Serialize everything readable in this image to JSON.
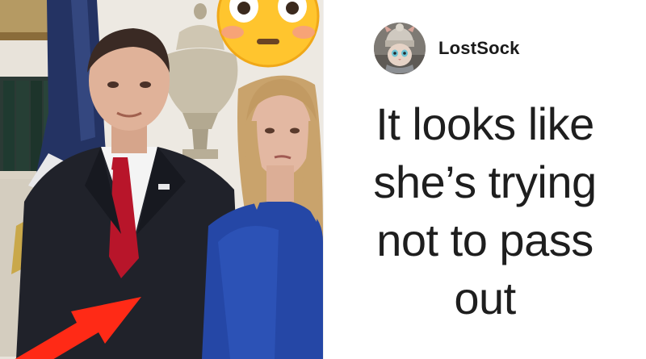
{
  "post": {
    "author": {
      "name": "LostSock",
      "avatar_icon": "cat-in-knit-hat-avatar-icon"
    },
    "caption_lines": [
      "It looks like",
      "she’s trying",
      "not to pass",
      "out"
    ]
  },
  "photo": {
    "overlay_emoji": "flushed-face-emoji",
    "overlay_arrow": "red-arrow",
    "colors": {
      "arrow": "#ff2a16",
      "emoji": "#ffc52e",
      "dress": "#2547a6",
      "suit": "#20222a",
      "tie": "#b8152a"
    }
  }
}
